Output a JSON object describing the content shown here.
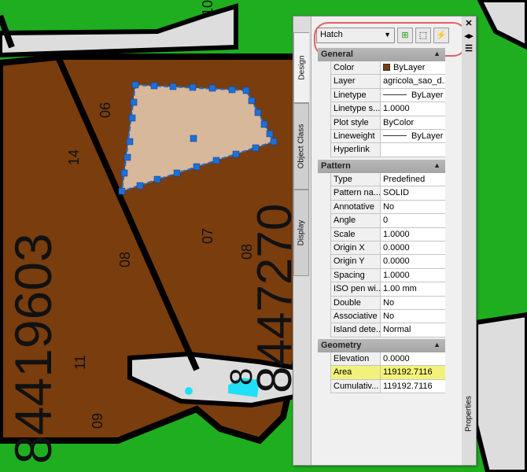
{
  "map": {
    "labels": [
      "84419603",
      "8447270",
      "14",
      "06",
      "08",
      "07",
      "08",
      "11",
      "09",
      "10",
      "8"
    ],
    "colors": {
      "green": "#1fae1f",
      "brown": "#7a3d0d",
      "hatch": "#d8b89a",
      "grip": "#1e6fd8",
      "cyan": "#20e0f8"
    }
  },
  "panel": {
    "tabs": [
      "Design",
      "Object Class",
      "Display"
    ],
    "selector": "Hatch",
    "toolbar_icons": [
      "toggle-pickadd-icon",
      "select-objects-icon",
      "quick-select-icon"
    ],
    "side_label": "Properties",
    "sections": [
      {
        "title": "General",
        "rows": [
          {
            "k": "Color",
            "v": "ByLayer"
          },
          {
            "k": "Layer",
            "v": "agricola_sao_d..."
          },
          {
            "k": "Linetype",
            "v": "ByLayer"
          },
          {
            "k": "Linetype s...",
            "v": "1.0000"
          },
          {
            "k": "Plot style",
            "v": "ByColor"
          },
          {
            "k": "Lineweight",
            "v": "ByLayer"
          },
          {
            "k": "Hyperlink",
            "v": ""
          }
        ]
      },
      {
        "title": "Pattern",
        "rows": [
          {
            "k": "Type",
            "v": "Predefined"
          },
          {
            "k": "Pattern na...",
            "v": "SOLID"
          },
          {
            "k": "Annotative",
            "v": "No"
          },
          {
            "k": "Angle",
            "v": "0"
          },
          {
            "k": "Scale",
            "v": "1.0000"
          },
          {
            "k": "Origin X",
            "v": "0.0000"
          },
          {
            "k": "Origin Y",
            "v": "0.0000"
          },
          {
            "k": "Spacing",
            "v": "1.0000"
          },
          {
            "k": "ISO pen wi...",
            "v": "1.00 mm"
          },
          {
            "k": "Double",
            "v": "No"
          },
          {
            "k": "Associative",
            "v": "No"
          },
          {
            "k": "Island dete...",
            "v": "Normal"
          }
        ]
      },
      {
        "title": "Geometry",
        "rows": [
          {
            "k": "Elevation",
            "v": "0.0000"
          },
          {
            "k": "Area",
            "v": "119192.7116"
          },
          {
            "k": "Cumulativ...",
            "v": "119192.7116"
          }
        ]
      }
    ]
  }
}
